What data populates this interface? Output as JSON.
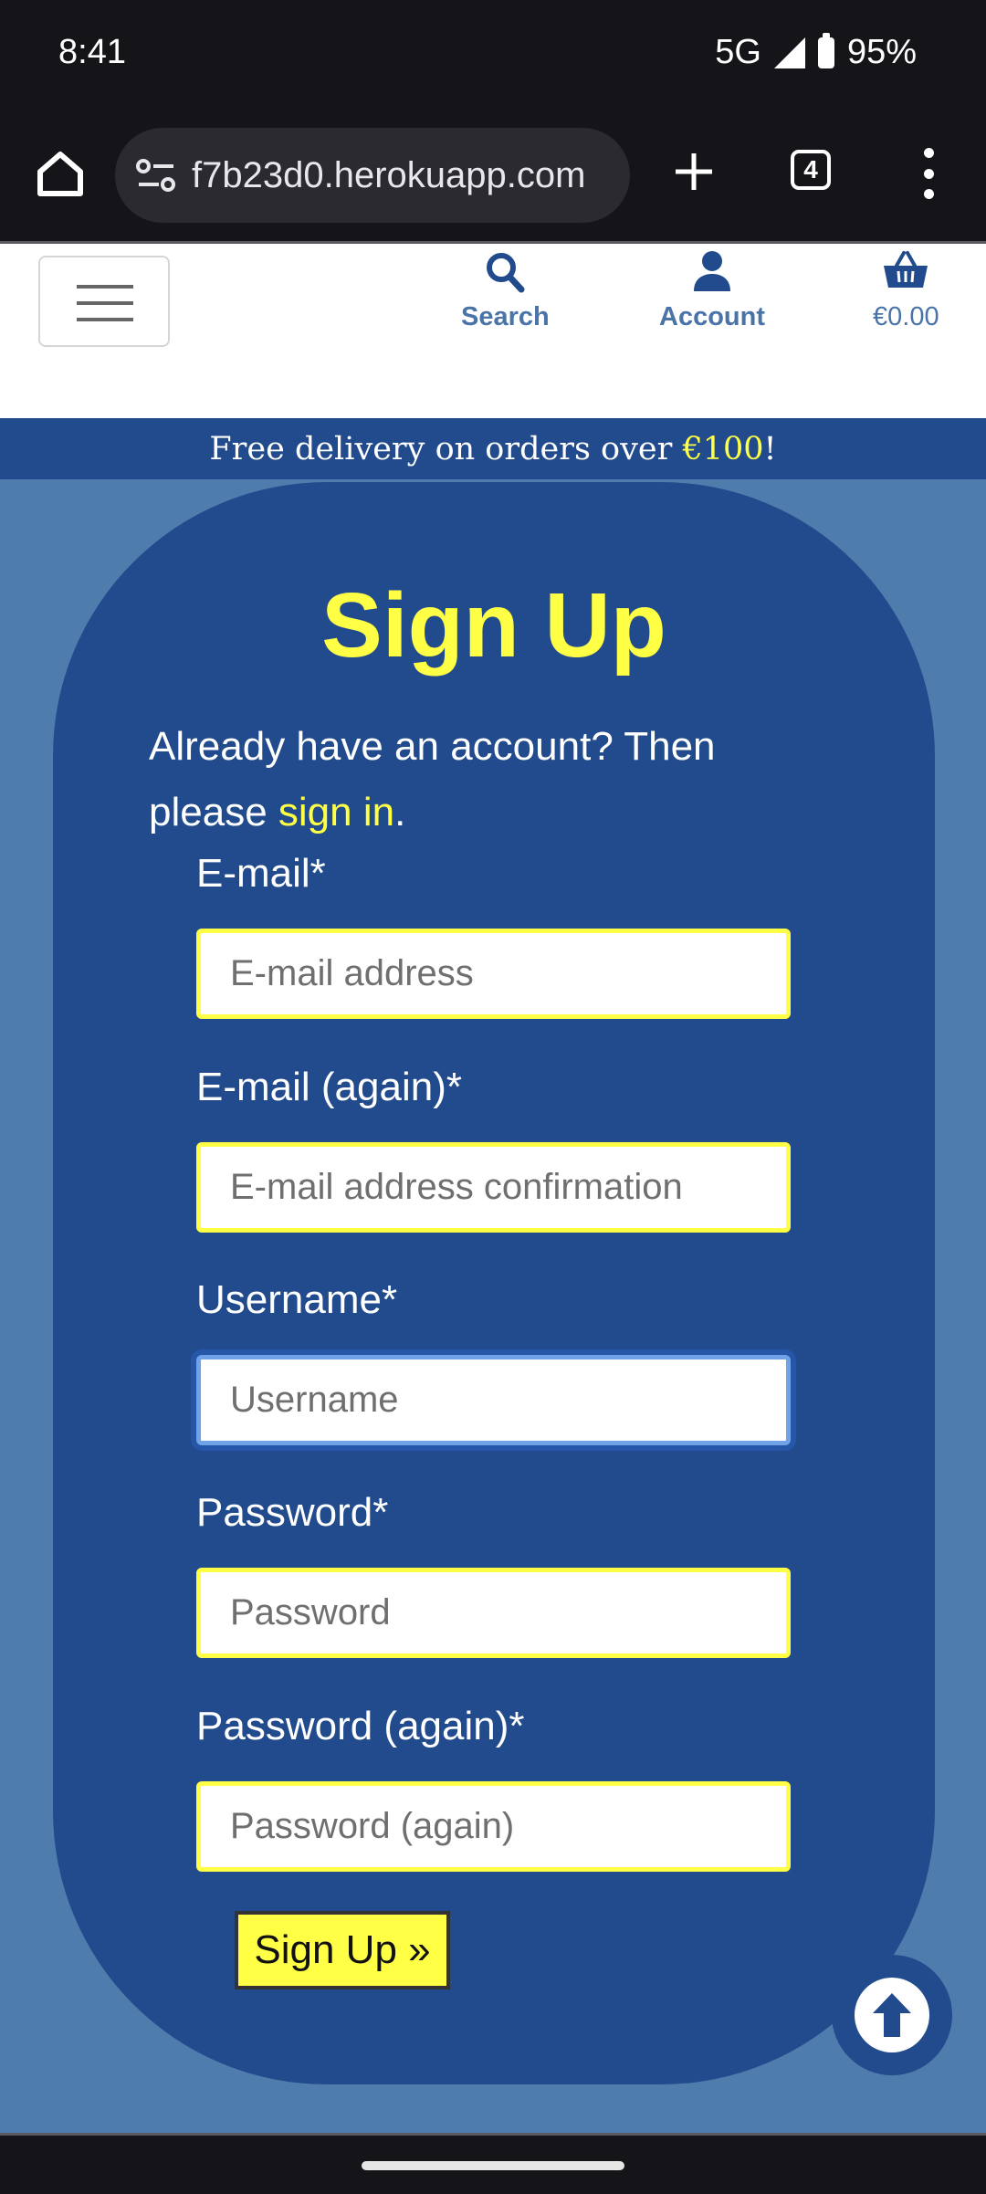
{
  "status_bar": {
    "time": "8:41",
    "network": "5G",
    "battery": "95%"
  },
  "browser": {
    "url": "f7b23d0.herokuapp.com",
    "tab_count": "4"
  },
  "header": {
    "nav": [
      {
        "label": "Search",
        "icon": "search-icon"
      },
      {
        "label": "Account",
        "icon": "user-icon"
      },
      {
        "label": "€0.00",
        "icon": "basket-icon"
      }
    ]
  },
  "banner": {
    "text_before": "Free delivery on orders over ",
    "price": "€100",
    "text_after": "!"
  },
  "signup": {
    "title": "Sign Up",
    "intro_before": "Already have an account? Then please ",
    "intro_link": "sign in",
    "intro_after": ".",
    "fields": [
      {
        "label": "E-mail*",
        "placeholder": "E-mail address",
        "value": ""
      },
      {
        "label": "E-mail (again)*",
        "placeholder": "E-mail address confirmation",
        "value": ""
      },
      {
        "label": "Username*",
        "placeholder": "Username",
        "value": "",
        "focused": true
      },
      {
        "label": "Password*",
        "placeholder": "Password",
        "value": ""
      },
      {
        "label": "Password (again)*",
        "placeholder": "Password (again)",
        "value": ""
      }
    ],
    "submit_label": "Sign Up »"
  },
  "colors": {
    "accent_yellow": "#ffff46",
    "brand_blue": "#214b8c",
    "page_blue": "#4e7cad",
    "focus_blue": "#6fa2e6"
  }
}
